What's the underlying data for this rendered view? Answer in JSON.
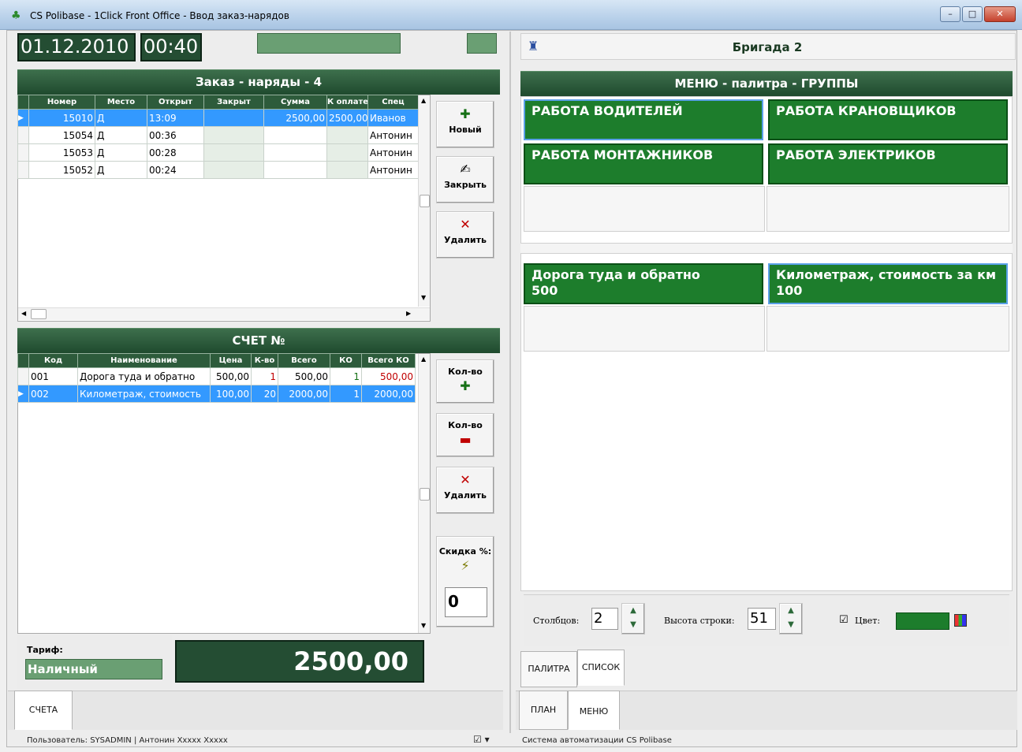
{
  "window": {
    "title": "CS Polibase - 1Click Front Office - Ввод заказ-нарядов",
    "buttons": [
      "–",
      "□",
      "✕"
    ]
  },
  "topbar": {
    "date": "01.12.2010",
    "time": "00:40"
  },
  "orders": {
    "header": "Заказ - наряды - 4",
    "columns": [
      "Номер",
      "Место",
      "Открыт",
      "Закрыт",
      "Сумма",
      "К оплате",
      "Спец"
    ],
    "rows": [
      {
        "num": "15010",
        "place": "Д",
        "opened": "13:09",
        "closed": "",
        "sum": "2500,00",
        "topay": "2500,00",
        "spec": "Иванов"
      },
      {
        "num": "15054",
        "place": "Д",
        "opened": "00:36",
        "closed": "",
        "sum": "",
        "topay": "",
        "spec": "Антонин"
      },
      {
        "num": "15053",
        "place": "Д",
        "opened": "00:28",
        "closed": "",
        "sum": "",
        "topay": "",
        "spec": "Антонин"
      },
      {
        "num": "15052",
        "place": "Д",
        "opened": "00:24",
        "closed": "",
        "sum": "",
        "topay": "",
        "spec": "Антонин"
      }
    ],
    "buttons": {
      "new": "Новый",
      "close": "Закрыть",
      "delete": "Удалить"
    }
  },
  "bill": {
    "header": "СЧЕТ №",
    "columns": [
      "Код",
      "Наименование",
      "Цена",
      "К-во",
      "Всего",
      "КО",
      "Всего КО"
    ],
    "rows": [
      {
        "code": "001",
        "name": "Дорога туда и обратно",
        "price": "500,00",
        "qty": "1",
        "total": "500,00",
        "ko": "1",
        "total_ko": "500,00"
      },
      {
        "code": "002",
        "name": "Километраж, стоимость",
        "price": "100,00",
        "qty": "20",
        "total": "2000,00",
        "ko": "1",
        "total_ko": "2000,00"
      }
    ],
    "buttons": {
      "qty_plus": "Кол-во",
      "qty_minus": "Кол-во",
      "delete": "Удалить",
      "discount": "Скидка %:"
    },
    "discount_value": "0",
    "tariff_label": "Тариф:",
    "tariff_value": "Наличный",
    "total": "2500,00"
  },
  "left_tabs": [
    "СЧЕТА"
  ],
  "status_left": "Пользователь: SYSADMIN | Антонин Хxxxx Хxxxx",
  "right": {
    "brigade": "Бригада 2",
    "menu_header": "МЕНЮ - палитра - ГРУППЫ",
    "groups": [
      "РАБОТА ВОДИТЕЛЕЙ",
      "РАБОТА КРАНОВЩИКОВ",
      "РАБОТА МОНТАЖНИКОВ",
      "РАБОТА ЭЛЕКТРИКОВ"
    ],
    "items": [
      {
        "name": "Дорога туда и обратно",
        "price": "500"
      },
      {
        "name": "Километраж, стоимость за км",
        "price": "100"
      }
    ],
    "settings": {
      "columns_label": "Столбцов:",
      "columns_value": "2",
      "row_height_label": "Высота строки:",
      "row_height_value": "51",
      "color_label": "Цвет:"
    },
    "view_tabs": [
      "ПАЛИТРА",
      "СПИСОК"
    ],
    "bottom_tabs": [
      "ПЛАН",
      "МЕНЮ"
    ],
    "status": "Система автоматизации CS Polibase"
  },
  "colors": {
    "accent_green": "#1d7d2c",
    "header_green": "#2d5b3b",
    "selection": "#3399ff"
  }
}
